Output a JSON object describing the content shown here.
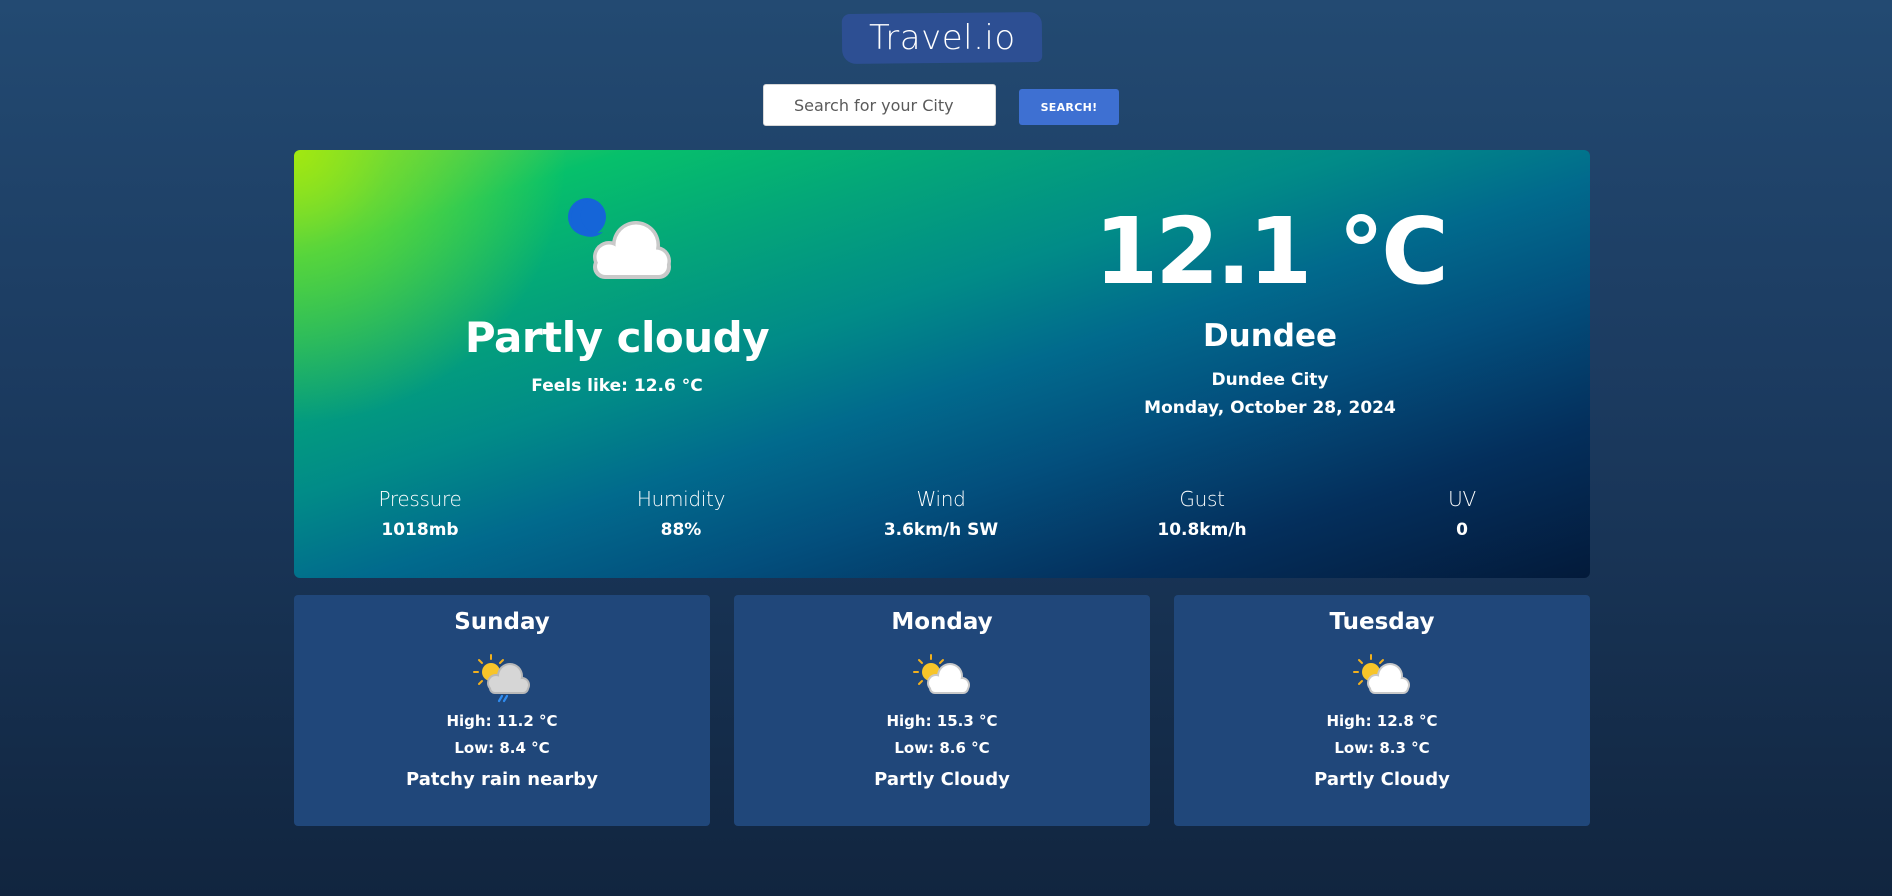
{
  "header": {
    "logo_text": "Travel.io",
    "search_placeholder": "Search for your City",
    "search_value": "",
    "search_button": "SEARCH!"
  },
  "current": {
    "icon": "partly-cloudy-night-icon",
    "condition": "Partly cloudy",
    "feels_like": "Feels like: 12.6 °C",
    "temperature": "12.1 °C",
    "city": "Dundee",
    "region": "Dundee City",
    "date": "Monday, October 28, 2024",
    "stats": [
      {
        "label": "Pressure",
        "value": "1018mb"
      },
      {
        "label": "Humidity",
        "value": "88%"
      },
      {
        "label": "Wind",
        "value": "3.6km/h SW"
      },
      {
        "label": "Gust",
        "value": "10.8km/h"
      },
      {
        "label": "UV",
        "value": "0"
      }
    ]
  },
  "forecast": [
    {
      "day": "Sunday",
      "icon": "patchy-rain-icon",
      "high": "High: 11.2 °C",
      "low": "Low: 8.4 °C",
      "description": "Patchy rain nearby"
    },
    {
      "day": "Monday",
      "icon": "partly-cloudy-icon",
      "high": "High: 15.3 °C",
      "low": "Low: 8.6 °C",
      "description": "Partly Cloudy"
    },
    {
      "day": "Tuesday",
      "icon": "partly-cloudy-icon",
      "high": "High: 12.8 °C",
      "low": "Low: 8.3 °C",
      "description": "Partly Cloudy"
    }
  ],
  "colors": {
    "background_top": "#234a72",
    "background_bottom": "#11253f",
    "logo_bg": "#2d4f93",
    "search_button_bg": "#3e70d2",
    "forecast_card_bg": "#20477a",
    "card_gradient_start": "#a2e810",
    "card_gradient_mid": "#06c06b",
    "card_gradient_end": "#031a3a"
  }
}
